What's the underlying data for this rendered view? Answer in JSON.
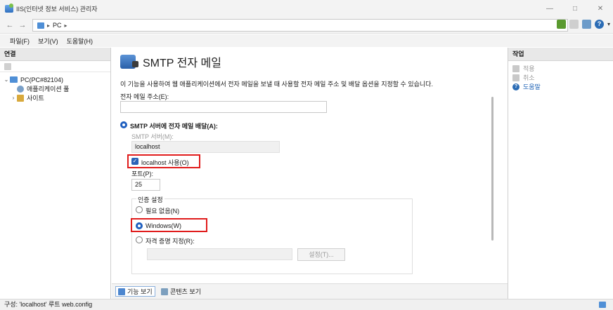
{
  "window": {
    "title": "IIS(인터넷 정보 서비스) 관리자",
    "controls": {
      "minimize": "—",
      "maximize": "□",
      "close": "✕"
    }
  },
  "address_bar": {
    "back": "←",
    "forward": "→",
    "breadcrumb": [
      "PC",
      "▸"
    ],
    "help_glyph": "?"
  },
  "menu": {
    "items": [
      "파일(F)",
      "보기(V)",
      "도움말(H)"
    ]
  },
  "connections": {
    "header": "연결",
    "tree": [
      {
        "label": "PC(PC#82104)",
        "expander": "⌄",
        "icon": "server-icon"
      },
      {
        "label": "애플리케이션 풀",
        "expander": "",
        "icon": "app-pool-icon"
      },
      {
        "label": "사이트",
        "expander": "›",
        "icon": "sites-icon"
      }
    ]
  },
  "feature": {
    "title": "SMTP 전자 메일",
    "description": "이 기능을 사용하여 웹 애플리케이션에서 전자 메일을 보낼 때 사용할 전자 메일 주소 및 배달 옵션을 지정할 수 있습니다.",
    "email_label": "전자 메일 주소(E):",
    "email_value": "",
    "delivery_label": "SMTP 서버에 전자 메일 배달(A):",
    "smtp_server_label": "SMTP 서버(M):",
    "smtp_server_value": "localhost",
    "use_localhost_label": "localhost 사용(O)",
    "use_localhost_checked": true,
    "port_label": "포트(P):",
    "port_value": "25",
    "auth": {
      "group_label": "인증 설정",
      "options": [
        "필요 없음(N)",
        "Windows(W)",
        "자격 증명 지정(R):"
      ],
      "selected": "Windows(W)",
      "credentials_value": "",
      "settings_button": "설정(T)..."
    }
  },
  "view_tabs": [
    "기능 보기",
    "콘텐츠 보기"
  ],
  "actions": {
    "header": "작업",
    "items": [
      {
        "label": "적용",
        "enabled": false
      },
      {
        "label": "취소",
        "enabled": false
      },
      {
        "label": "도움말",
        "enabled": true
      }
    ]
  },
  "status": {
    "text": "구성: 'localhost' 루트 web.config"
  },
  "colors": {
    "accent": "#1f5fbf",
    "highlight_box": "#e01c1c",
    "link": "#1a5fb4"
  }
}
